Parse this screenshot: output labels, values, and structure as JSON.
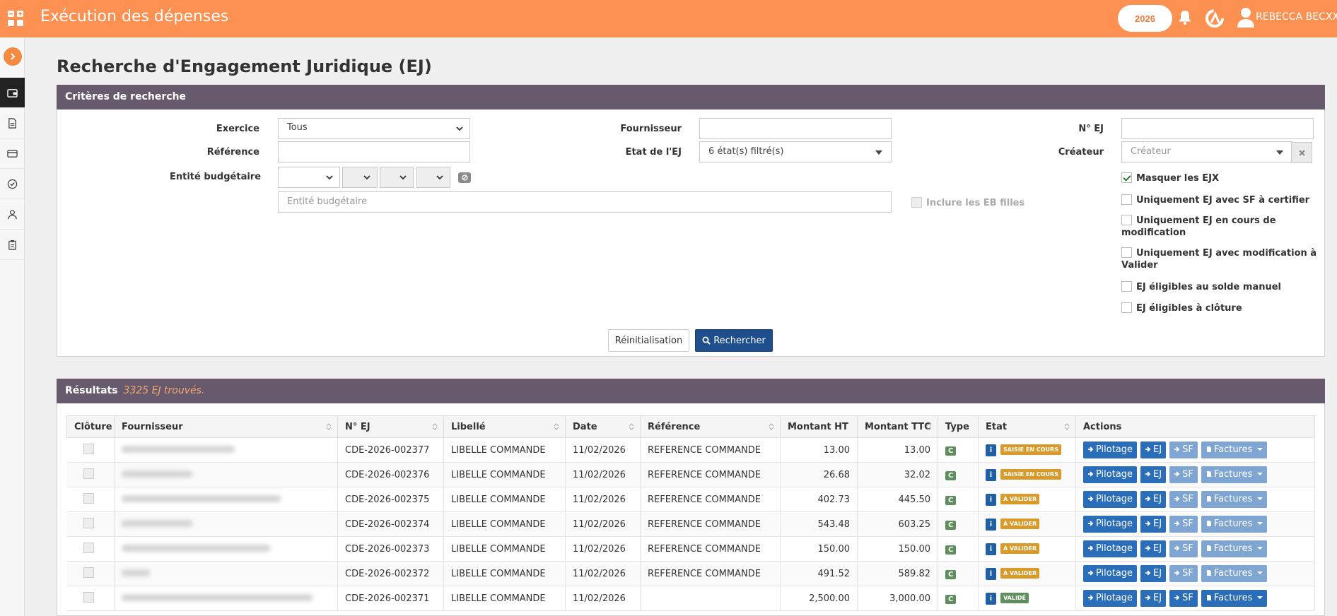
{
  "header": {
    "app_title": "Exécution des dépenses",
    "year": "2026",
    "user_name": "REBECCA BECXX"
  },
  "page": {
    "title": "Recherche d'Engagement Juridique (EJ)"
  },
  "criteria": {
    "panel_title": "Critères de recherche",
    "exercice_label": "Exercice",
    "exercice_value": "Tous",
    "fournisseur_label": "Fournisseur",
    "fournisseur_value": "",
    "num_ej_label": "N° EJ",
    "num_ej_value": "",
    "reference_label": "Référence",
    "reference_value": "",
    "etat_label": "Etat de l'EJ",
    "etat_value": "6 état(s) filtré(s)",
    "createur_label": "Créateur",
    "createur_placeholder": "Créateur",
    "entite_label": "Entité budgétaire",
    "entite_placeholder": "Entité budgétaire",
    "inclure_eb_filles": "Inclure les EB filles",
    "checkboxes": [
      {
        "label": "Masquer les EJX",
        "checked": true
      },
      {
        "label": "Uniquement EJ avec SF à certifier",
        "checked": false
      },
      {
        "label": "Uniquement EJ en cours de modification",
        "checked": false
      },
      {
        "label": "Uniquement EJ avec modification à Valider",
        "checked": false
      },
      {
        "label": "EJ éligibles au solde manuel",
        "checked": false
      },
      {
        "label": "EJ éligibles à clôture",
        "checked": false
      }
    ],
    "reset_label": "Réinitialisation",
    "search_label": "Rechercher"
  },
  "results": {
    "panel_title": "Résultats",
    "count_text": "3325 EJ trouvés.",
    "columns": [
      "Clôture",
      "Fournisseur",
      "N° EJ",
      "Libellé",
      "Date",
      "Référence",
      "Montant HT",
      "Montant TTC",
      "Type",
      "Etat",
      "Actions"
    ],
    "rows": [
      {
        "num": "CDE-2026-002377",
        "libelle": "LIBELLE COMMANDE",
        "date": "11/02/2026",
        "reference": "REFERENCE COMMANDE",
        "ht": "13.00",
        "ttc": "13.00",
        "type": "C",
        "etat": "SAISIE EN COURS",
        "etat_color": "#d99a29",
        "sf_enabled": false
      },
      {
        "num": "CDE-2026-002376",
        "libelle": "LIBELLE COMMANDE",
        "date": "11/02/2026",
        "reference": "REFERENCE COMMANDE",
        "ht": "26.68",
        "ttc": "32.02",
        "type": "C",
        "etat": "SAISIE EN COURS",
        "etat_color": "#d99a29",
        "sf_enabled": false
      },
      {
        "num": "CDE-2026-002375",
        "libelle": "LIBELLE COMMANDE",
        "date": "11/02/2026",
        "reference": "REFERENCE COMMANDE",
        "ht": "402.73",
        "ttc": "445.50",
        "type": "C",
        "etat": "À VALIDER",
        "etat_color": "#d99a29",
        "sf_enabled": false
      },
      {
        "num": "CDE-2026-002374",
        "libelle": "LIBELLE COMMANDE",
        "date": "11/02/2026",
        "reference": "REFERENCE COMMANDE",
        "ht": "543.48",
        "ttc": "603.25",
        "type": "C",
        "etat": "À VALIDER",
        "etat_color": "#d99a29",
        "sf_enabled": false
      },
      {
        "num": "CDE-2026-002373",
        "libelle": "LIBELLE COMMANDE",
        "date": "11/02/2026",
        "reference": "REFERENCE COMMANDE",
        "ht": "150.00",
        "ttc": "150.00",
        "type": "C",
        "etat": "À VALIDER",
        "etat_color": "#d99a29",
        "sf_enabled": false
      },
      {
        "num": "CDE-2026-002372",
        "libelle": "LIBELLE COMMANDE",
        "date": "11/02/2026",
        "reference": "REFERENCE COMMANDE",
        "ht": "491.52",
        "ttc": "589.82",
        "type": "C",
        "etat": "À VALIDER",
        "etat_color": "#d99a29",
        "sf_enabled": false
      },
      {
        "num": "CDE-2026-002371",
        "libelle": "LIBELLE COMMANDE",
        "date": "11/02/2026",
        "reference": "",
        "ht": "2,500.00",
        "ttc": "3,000.00",
        "type": "C",
        "etat": "VALIDÉ",
        "etat_color": "#5e8e5e",
        "sf_enabled": true
      }
    ],
    "actions": {
      "pilotage": "Pilotage",
      "ej": "EJ",
      "sf": "SF",
      "factures": "Factures"
    }
  },
  "colors": {
    "topbar": "#fd9152",
    "panel_header": "#675a6c",
    "primary_button": "#1e4f8c",
    "action_button": "#2a6db8"
  }
}
